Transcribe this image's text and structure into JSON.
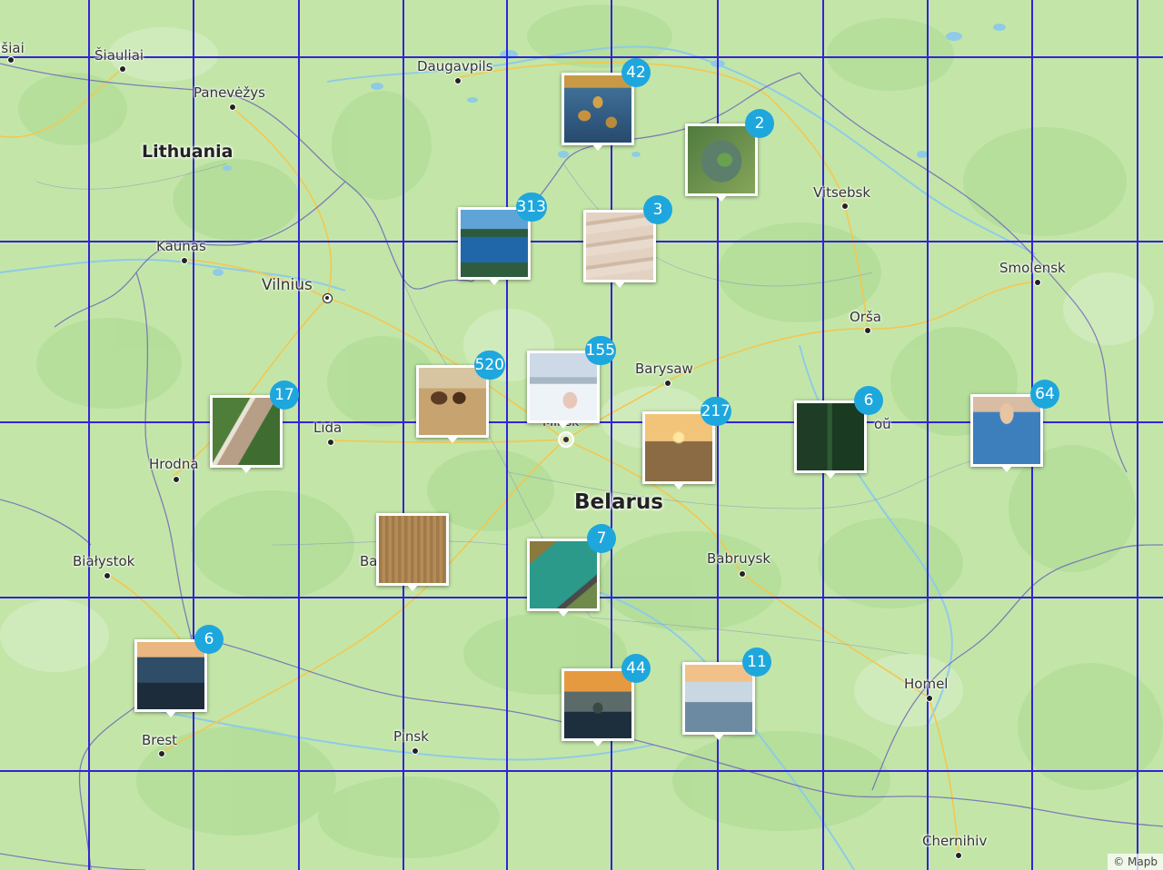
{
  "map": {
    "countries": [
      "Lithuania",
      "Belarus"
    ],
    "cities": [
      "Šiauliai",
      "Daugavpils",
      "Panevėžys",
      "Kaunas",
      "Vilnius",
      "Vitsebsk",
      "Smolensk",
      "Orša",
      "Barysaw",
      "Lida",
      "Hrodna",
      "Białystok",
      "Babruysk",
      "Homel",
      "Brest",
      "Pinsk",
      "Chernihiv",
      "Minsk"
    ],
    "colors": {
      "land": "#bfe3a3",
      "grid": "#3522d9",
      "badge": "#1ea7dd",
      "border": "#6e63b8",
      "road": "#f3c750"
    }
  },
  "clusters": [
    {
      "count": "42",
      "icon": "wetland-islands-photo"
    },
    {
      "count": "2",
      "icon": "heart-island-photo"
    },
    {
      "count": "313",
      "icon": "river-forest-photo"
    },
    {
      "count": "3",
      "icon": "sand-dunes-photo"
    },
    {
      "count": "155",
      "icon": "winter-landscape-photo"
    },
    {
      "count": "520",
      "icon": "bison-photo"
    },
    {
      "count": "17",
      "icon": "aerial-fields-photo"
    },
    {
      "count": "217",
      "icon": "sunset-field-photo"
    },
    {
      "count": "6",
      "icon": "forest-aerial-photo"
    },
    {
      "count": "64",
      "icon": "lake-shore-photo"
    },
    {
      "count": "",
      "icon": "harvest-field-photo"
    },
    {
      "count": "7",
      "icon": "aerial-lake-road-photo"
    },
    {
      "count": "6",
      "icon": "river-sunset-photo"
    },
    {
      "count": "44",
      "icon": "lake-tree-sunset-photo"
    },
    {
      "count": "11",
      "icon": "foggy-sunrise-photo"
    }
  ],
  "attribution": "© Mapb"
}
